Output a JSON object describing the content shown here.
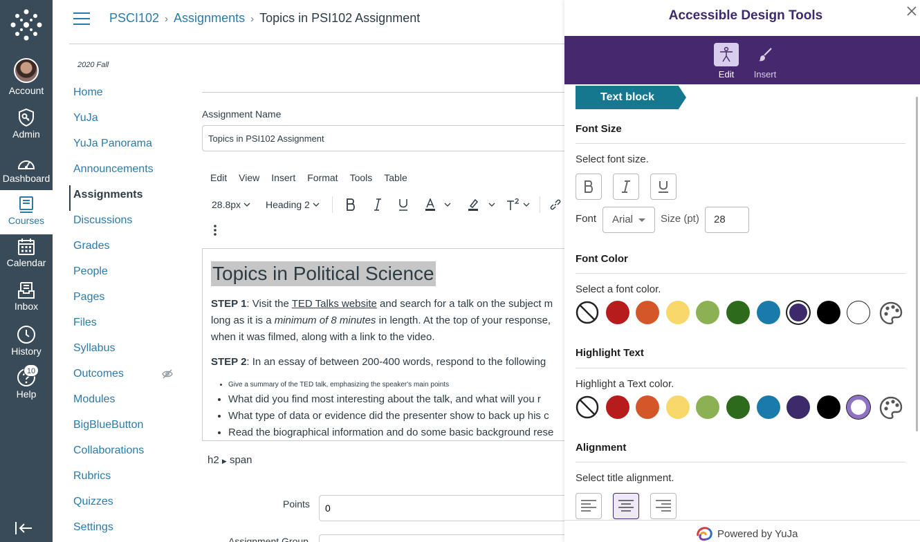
{
  "global_nav": {
    "items": [
      {
        "label": "Account",
        "icon": "avatar"
      },
      {
        "label": "Admin",
        "icon": "shield-key-icon"
      },
      {
        "label": "Dashboard",
        "icon": "dashboard-gauge-icon"
      },
      {
        "label": "Courses",
        "icon": "book-icon",
        "active": true
      },
      {
        "label": "Calendar",
        "icon": "calendar-icon"
      },
      {
        "label": "Inbox",
        "icon": "inbox-icon"
      },
      {
        "label": "History",
        "icon": "clock-icon"
      },
      {
        "label": "Help",
        "icon": "help-icon",
        "badge": "10"
      }
    ]
  },
  "breadcrumb": {
    "course": "PSCI102",
    "section": "Assignments",
    "current": "Topics in PSI102 Assignment"
  },
  "course_nav": {
    "term": "2020 Fall",
    "items": [
      {
        "label": "Home"
      },
      {
        "label": "YuJa"
      },
      {
        "label": "YuJa Panorama"
      },
      {
        "label": "Announcements"
      },
      {
        "label": "Assignments",
        "active": true
      },
      {
        "label": "Discussions"
      },
      {
        "label": "Grades"
      },
      {
        "label": "People"
      },
      {
        "label": "Pages"
      },
      {
        "label": "Files"
      },
      {
        "label": "Syllabus"
      },
      {
        "label": "Outcomes",
        "hidden_icon": true
      },
      {
        "label": "Modules"
      },
      {
        "label": "BigBlueButton"
      },
      {
        "label": "Collaborations"
      },
      {
        "label": "Rubrics"
      },
      {
        "label": "Quizzes"
      },
      {
        "label": "Settings"
      }
    ]
  },
  "form": {
    "assignment_name_label": "Assignment Name",
    "assignment_name_value": "Topics in PSI102 Assignment",
    "points_label": "Points",
    "points_value": "0",
    "cut_label": "Assignment Group"
  },
  "editor": {
    "menus": [
      "Edit",
      "View",
      "Insert",
      "Format",
      "Tools",
      "Table"
    ],
    "font_size": "28.8px",
    "block_format": "Heading 2",
    "heading": "Topics in Political Science",
    "step1_label": "STEP 1",
    "step1_a": ": Visit the ",
    "step1_link": "TED Talks website",
    "step1_b": " and search for a talk on the subject m",
    "step1_line2_a": "long as it is a ",
    "step1_line2_em": "minimum of 8 minutes",
    "step1_line2_b": " in length. At the top of your response,",
    "step1_line3": "when it was filmed, along with a link to the video.",
    "step2_label": "STEP 2",
    "step2_text": ": In an essay of between 200-400 words, respond to the following",
    "bullets": [
      "Give a summary of the TED talk, emphasizing the speaker's main points",
      "What did you find most interesting about the talk, and what will you r",
      "What type of data or evidence did the presenter show to back up his c",
      "Read the biographical information and do some basic background rese"
    ],
    "element_path": [
      "h2",
      "span"
    ]
  },
  "panel": {
    "title": "Accessible Design Tools",
    "tabs": [
      {
        "label": "Edit",
        "active": true
      },
      {
        "label": "Insert"
      }
    ],
    "tag": "Text block",
    "font_size_heading": "Font Size",
    "font_size_sub": "Select font size.",
    "font_label": "Font",
    "font_value": "Arial",
    "size_label": "Size (pt)",
    "size_value": "28",
    "font_color_heading": "Font Color",
    "font_color_sub": "Select a font color.",
    "highlight_heading": "Highlight Text",
    "highlight_sub": "Highlight a Text color.",
    "alignment_heading": "Alignment",
    "alignment_sub": "Select title alignment.",
    "footer": "Powered by YuJa",
    "palette": [
      "#b61c1c",
      "#d4572a",
      "#f8d86a",
      "#8bb152",
      "#2d6a1b",
      "#1a7bab",
      "#3d2a6b",
      "#000000",
      "#ffffff"
    ],
    "font_color_selected": 6,
    "highlight_selected": 8
  },
  "colors": {
    "nav_bg": "#394b58",
    "link": "#2a7aaa",
    "panel_header": "#46286e",
    "tag": "#16788f"
  }
}
